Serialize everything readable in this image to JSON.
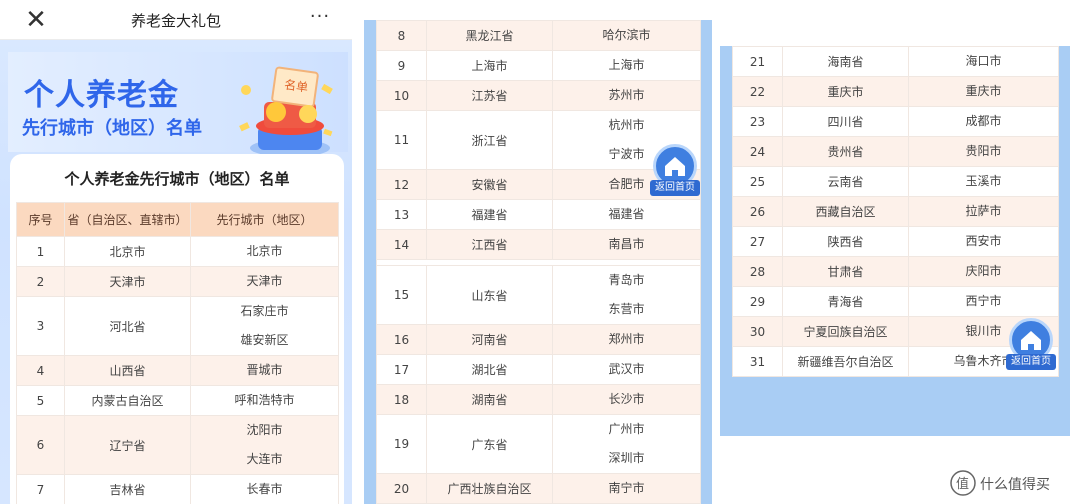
{
  "panel1": {
    "title": "养老金大礼包",
    "close_glyph": "✕",
    "more_glyph": "···",
    "banner": {
      "line1": "个人养老金",
      "line2": "先行城市（地区）名单",
      "tag": "名单"
    },
    "card_title": "个人养老金先行城市（地区）名单",
    "headers": [
      "序号",
      "省（自治区、直辖市）",
      "先行城市（地区）"
    ],
    "rows": [
      {
        "no": "1",
        "prov": "北京市",
        "cities": [
          "北京市"
        ]
      },
      {
        "no": "2",
        "prov": "天津市",
        "cities": [
          "天津市"
        ]
      },
      {
        "no": "3",
        "prov": "河北省",
        "cities": [
          "石家庄市",
          "雄安新区"
        ]
      },
      {
        "no": "4",
        "prov": "山西省",
        "cities": [
          "晋城市"
        ]
      },
      {
        "no": "5",
        "prov": "内蒙古自治区",
        "cities": [
          "呼和浩特市"
        ]
      },
      {
        "no": "6",
        "prov": "辽宁省",
        "cities": [
          "沈阳市",
          "大连市"
        ]
      },
      {
        "no": "7",
        "prov": "吉林省",
        "cities": [
          "长春市"
        ]
      }
    ]
  },
  "panel2": {
    "rows": [
      {
        "no": "8",
        "prov": "黑龙江省",
        "cities": [
          "哈尔滨市"
        ]
      },
      {
        "no": "9",
        "prov": "上海市",
        "cities": [
          "上海市"
        ]
      },
      {
        "no": "10",
        "prov": "江苏省",
        "cities": [
          "苏州市"
        ]
      },
      {
        "no": "11",
        "prov": "浙江省",
        "cities": [
          "杭州市",
          "宁波市"
        ]
      },
      {
        "no": "12",
        "prov": "安徽省",
        "cities": [
          "合肥市"
        ]
      },
      {
        "no": "13",
        "prov": "福建省",
        "cities": [
          "福建省"
        ]
      },
      {
        "no": "14",
        "prov": "江西省",
        "cities": [
          "南昌市"
        ]
      },
      {
        "no": "15",
        "prov": "山东省",
        "cities": [
          "青岛市",
          "东营市"
        ]
      },
      {
        "no": "16",
        "prov": "河南省",
        "cities": [
          "郑州市"
        ]
      },
      {
        "no": "17",
        "prov": "湖北省",
        "cities": [
          "武汉市"
        ]
      },
      {
        "no": "18",
        "prov": "湖南省",
        "cities": [
          "长沙市"
        ]
      },
      {
        "no": "19",
        "prov": "广东省",
        "cities": [
          "广州市",
          "深圳市"
        ]
      },
      {
        "no": "20",
        "prov": "广西壮族自治区",
        "cities": [
          "南宁市"
        ]
      }
    ]
  },
  "panel3": {
    "rows": [
      {
        "no": "21",
        "prov": "海南省",
        "cities": [
          "海口市"
        ]
      },
      {
        "no": "22",
        "prov": "重庆市",
        "cities": [
          "重庆市"
        ]
      },
      {
        "no": "23",
        "prov": "四川省",
        "cities": [
          "成都市"
        ]
      },
      {
        "no": "24",
        "prov": "贵州省",
        "cities": [
          "贵阳市"
        ]
      },
      {
        "no": "25",
        "prov": "云南省",
        "cities": [
          "玉溪市"
        ]
      },
      {
        "no": "26",
        "prov": "西藏自治区",
        "cities": [
          "拉萨市"
        ]
      },
      {
        "no": "27",
        "prov": "陕西省",
        "cities": [
          "西安市"
        ]
      },
      {
        "no": "28",
        "prov": "甘肃省",
        "cities": [
          "庆阳市"
        ]
      },
      {
        "no": "29",
        "prov": "青海省",
        "cities": [
          "西宁市"
        ]
      },
      {
        "no": "30",
        "prov": "宁夏回族自治区",
        "cities": [
          "银川市"
        ]
      },
      {
        "no": "31",
        "prov": "新疆维吾尔自治区",
        "cities": [
          "乌鲁木齐市"
        ]
      }
    ]
  },
  "home_button": {
    "label": "返回首页",
    "icon": "home-icon"
  },
  "watermark": {
    "text": "什么值得买",
    "logo": "值"
  },
  "colors": {
    "header_bg": "#fbd9c0",
    "row_alt": "#fdf1ea",
    "accent_blue": "#2f66ea",
    "panel_bg": "#a9cdf4"
  }
}
